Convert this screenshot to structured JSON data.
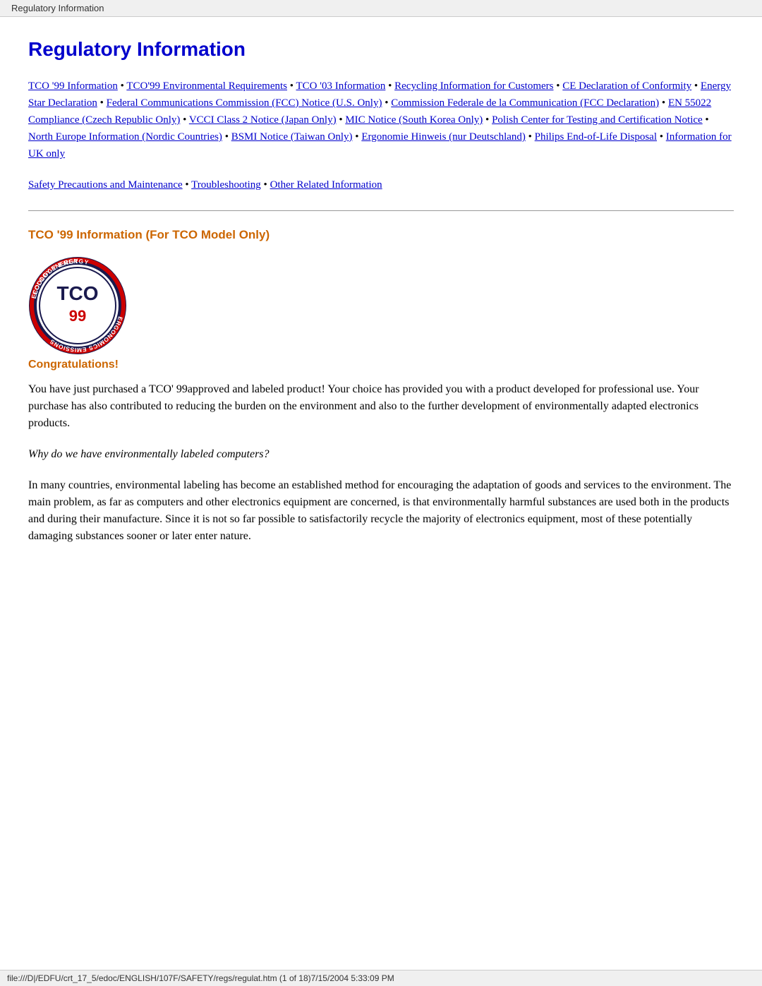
{
  "browser_tab": {
    "label": "Regulatory Information"
  },
  "page_title": "Regulatory Information",
  "nav_links": [
    {
      "label": "TCO '99 Information",
      "id": "tco99"
    },
    {
      "label": "TCO'99 Environmental Requirements",
      "id": "tco99env"
    },
    {
      "label": "TCO '03 Information",
      "id": "tco03"
    },
    {
      "label": "Recycling Information for Customers",
      "id": "recycling"
    },
    {
      "label": "CE Declaration of Conformity",
      "id": "ce"
    },
    {
      "label": "Energy Star Declaration",
      "id": "energystar"
    },
    {
      "label": "Federal Communications Commission (FCC) Notice (U.S. Only)",
      "id": "fcc"
    },
    {
      "label": "Commission Federale de la Communication (FCC Declaration)",
      "id": "fccfr"
    },
    {
      "label": "EN 55022 Compliance (Czech Republic Only)",
      "id": "en55022"
    },
    {
      "label": "VCCI Class 2 Notice (Japan Only)",
      "id": "vcci"
    },
    {
      "label": "MIC Notice (South Korea Only)",
      "id": "mic"
    },
    {
      "label": "Polish Center for Testing and Certification Notice",
      "id": "polish"
    },
    {
      "label": "North Europe Information (Nordic Countries)",
      "id": "nordic"
    },
    {
      "label": "BSMI Notice (Taiwan Only)",
      "id": "bsmi"
    },
    {
      "label": "Ergonomie Hinweis (nur Deutschland)",
      "id": "ergonomie"
    },
    {
      "label": "Philips End-of-Life Disposal",
      "id": "philips"
    },
    {
      "label": "Information for UK only",
      "id": "uk"
    }
  ],
  "secondary_links": [
    {
      "label": "Safety Precautions and Maintenance",
      "id": "safety"
    },
    {
      "label": "Troubleshooting",
      "id": "trouble"
    },
    {
      "label": "Other Related Information",
      "id": "other"
    }
  ],
  "tco_section": {
    "title": "TCO '99 Information (For TCO Model Only)",
    "congratulations_label": "Congratulations!",
    "para1": "You have just purchased a TCO' 99approved and labeled product! Your choice has provided you with a product developed for professional use. Your purchase has also contributed to reducing the burden on the environment and also to the further development of environmentally adapted electronics products.",
    "italic_para": "Why do we have environmentally labeled computers?",
    "para2": "In many countries, environmental labeling has become an established method for encouraging the adaptation of goods and services to the environment. The main problem, as far as computers and other electronics equipment are concerned, is that environmentally harmful substances are used both in the products and during their manufacture. Since it is not so far possible to satisfactorily recycle the majority of electronics equipment, most of these potentially damaging substances sooner or later enter nature."
  },
  "footer": {
    "text": "file:///D|/EDFU/crt_17_5/edoc/ENGLISH/107F/SAFETY/regs/regulat.htm (1 of 18)7/15/2004 5:33:09 PM"
  }
}
